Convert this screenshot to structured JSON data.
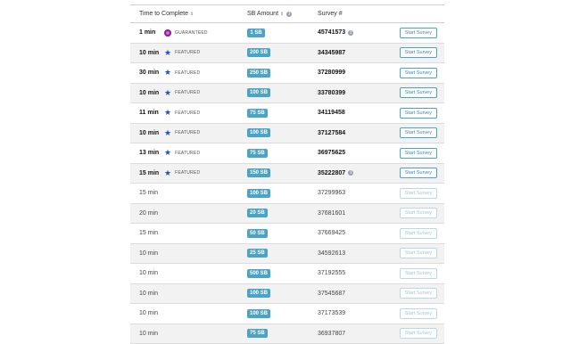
{
  "header": {
    "time_label": "Time to Complete",
    "sort_glyph": "⇕",
    "amount_label": "SB Amount",
    "amount_sort_glyph": "⇕",
    "info_glyph": "i",
    "survey_label": "Survey #"
  },
  "colors": {
    "sb_pill": "#4ba3c7",
    "featured_star": "#1f4fd1",
    "guaranteed_icon": "#8a1f8f",
    "button_border": "#4ba3c7"
  },
  "rows": [
    {
      "time": "1 min",
      "badge": "GUARANTEED",
      "badge_icon": "guaranteed-icon",
      "amount": "1 SB",
      "survey": "45741573",
      "info": true,
      "button": "Start Survey",
      "emphasis": true
    },
    {
      "time": "10 min",
      "badge": "FEATURED",
      "badge_icon": "star-icon",
      "amount": "200 SB",
      "survey": "34345987",
      "info": false,
      "button": "Start Survey",
      "emphasis": true
    },
    {
      "time": "30 min",
      "badge": "FEATURED",
      "badge_icon": "star-icon",
      "amount": "250 SB",
      "survey": "37280999",
      "info": false,
      "button": "Start Survey",
      "emphasis": true
    },
    {
      "time": "10 min",
      "badge": "FEATURED",
      "badge_icon": "star-icon",
      "amount": "100 SB",
      "survey": "33780399",
      "info": false,
      "button": "Start Survey",
      "emphasis": true
    },
    {
      "time": "11 min",
      "badge": "FEATURED",
      "badge_icon": "star-icon",
      "amount": "75 SB",
      "survey": "34119458",
      "info": false,
      "button": "Start Survey",
      "emphasis": true
    },
    {
      "time": "10 min",
      "badge": "FEATURED",
      "badge_icon": "star-icon",
      "amount": "100 SB",
      "survey": "37127584",
      "info": false,
      "button": "Start Survey",
      "emphasis": true
    },
    {
      "time": "13 min",
      "badge": "FEATURED",
      "badge_icon": "star-icon",
      "amount": "75 SB",
      "survey": "36975625",
      "info": false,
      "button": "Start Survey",
      "emphasis": true
    },
    {
      "time": "15 min",
      "badge": "FEATURED",
      "badge_icon": "star-icon",
      "amount": "150 SB",
      "survey": "35222807",
      "info": true,
      "button": "Start Survey",
      "emphasis": true
    },
    {
      "time": "15 min",
      "badge": "",
      "badge_icon": "",
      "amount": "100 SB",
      "survey": "37299963",
      "info": false,
      "button": "Start Survey",
      "emphasis": false
    },
    {
      "time": "20 min",
      "badge": "",
      "badge_icon": "",
      "amount": "20 SB",
      "survey": "37681601",
      "info": false,
      "button": "Start Survey",
      "emphasis": false
    },
    {
      "time": "15 min",
      "badge": "",
      "badge_icon": "",
      "amount": "50 SB",
      "survey": "37669425",
      "info": false,
      "button": "Start Survey",
      "emphasis": false
    },
    {
      "time": "10 min",
      "badge": "",
      "badge_icon": "",
      "amount": "25 SB",
      "survey": "34592613",
      "info": false,
      "button": "Start Survey",
      "emphasis": false
    },
    {
      "time": "10 min",
      "badge": "",
      "badge_icon": "",
      "amount": "500 SB",
      "survey": "37192555",
      "info": false,
      "button": "Start Survey",
      "emphasis": false
    },
    {
      "time": "10 min",
      "badge": "",
      "badge_icon": "",
      "amount": "100 SB",
      "survey": "37545687",
      "info": false,
      "button": "Start Survey",
      "emphasis": false
    },
    {
      "time": "10 min",
      "badge": "",
      "badge_icon": "",
      "amount": "100 SB",
      "survey": "37173539",
      "info": false,
      "button": "Start Survey",
      "emphasis": false
    },
    {
      "time": "10 min",
      "badge": "",
      "badge_icon": "",
      "amount": "75 SB",
      "survey": "36937807",
      "info": false,
      "button": "Start Survey",
      "emphasis": false
    }
  ]
}
